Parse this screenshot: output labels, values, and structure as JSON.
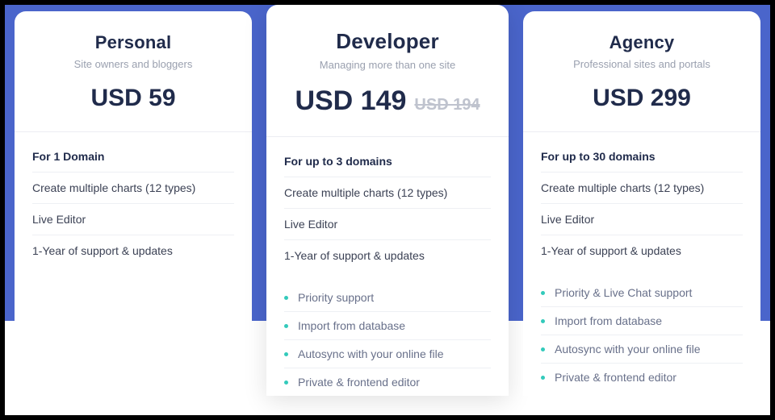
{
  "plans": [
    {
      "name": "Personal",
      "tagline": "Site owners and bloggers",
      "price": "USD 59",
      "price_old": "",
      "lead": "For 1 Domain",
      "features": [
        "Create multiple charts (12 types)",
        "Live Editor",
        "1-Year of support & updates"
      ],
      "extras": []
    },
    {
      "name": "Developer",
      "tagline": "Managing more than one site",
      "price": "USD 149",
      "price_old": "USD 194",
      "lead": "For up to 3 domains",
      "features": [
        "Create multiple charts (12 types)",
        "Live Editor",
        "1-Year of support & updates"
      ],
      "extras": [
        "Priority support",
        "Import from database",
        "Autosync with your online file",
        "Private & frontend editor"
      ]
    },
    {
      "name": "Agency",
      "tagline": "Professional sites and portals",
      "price": "USD 299",
      "price_old": "",
      "lead": "For up to 30 domains",
      "features": [
        "Create multiple charts (12 types)",
        "Live Editor",
        "1-Year of support & updates"
      ],
      "extras": [
        "Priority & Live Chat support",
        "Import from database",
        "Autosync with your online file",
        "Private & frontend editor"
      ]
    }
  ]
}
